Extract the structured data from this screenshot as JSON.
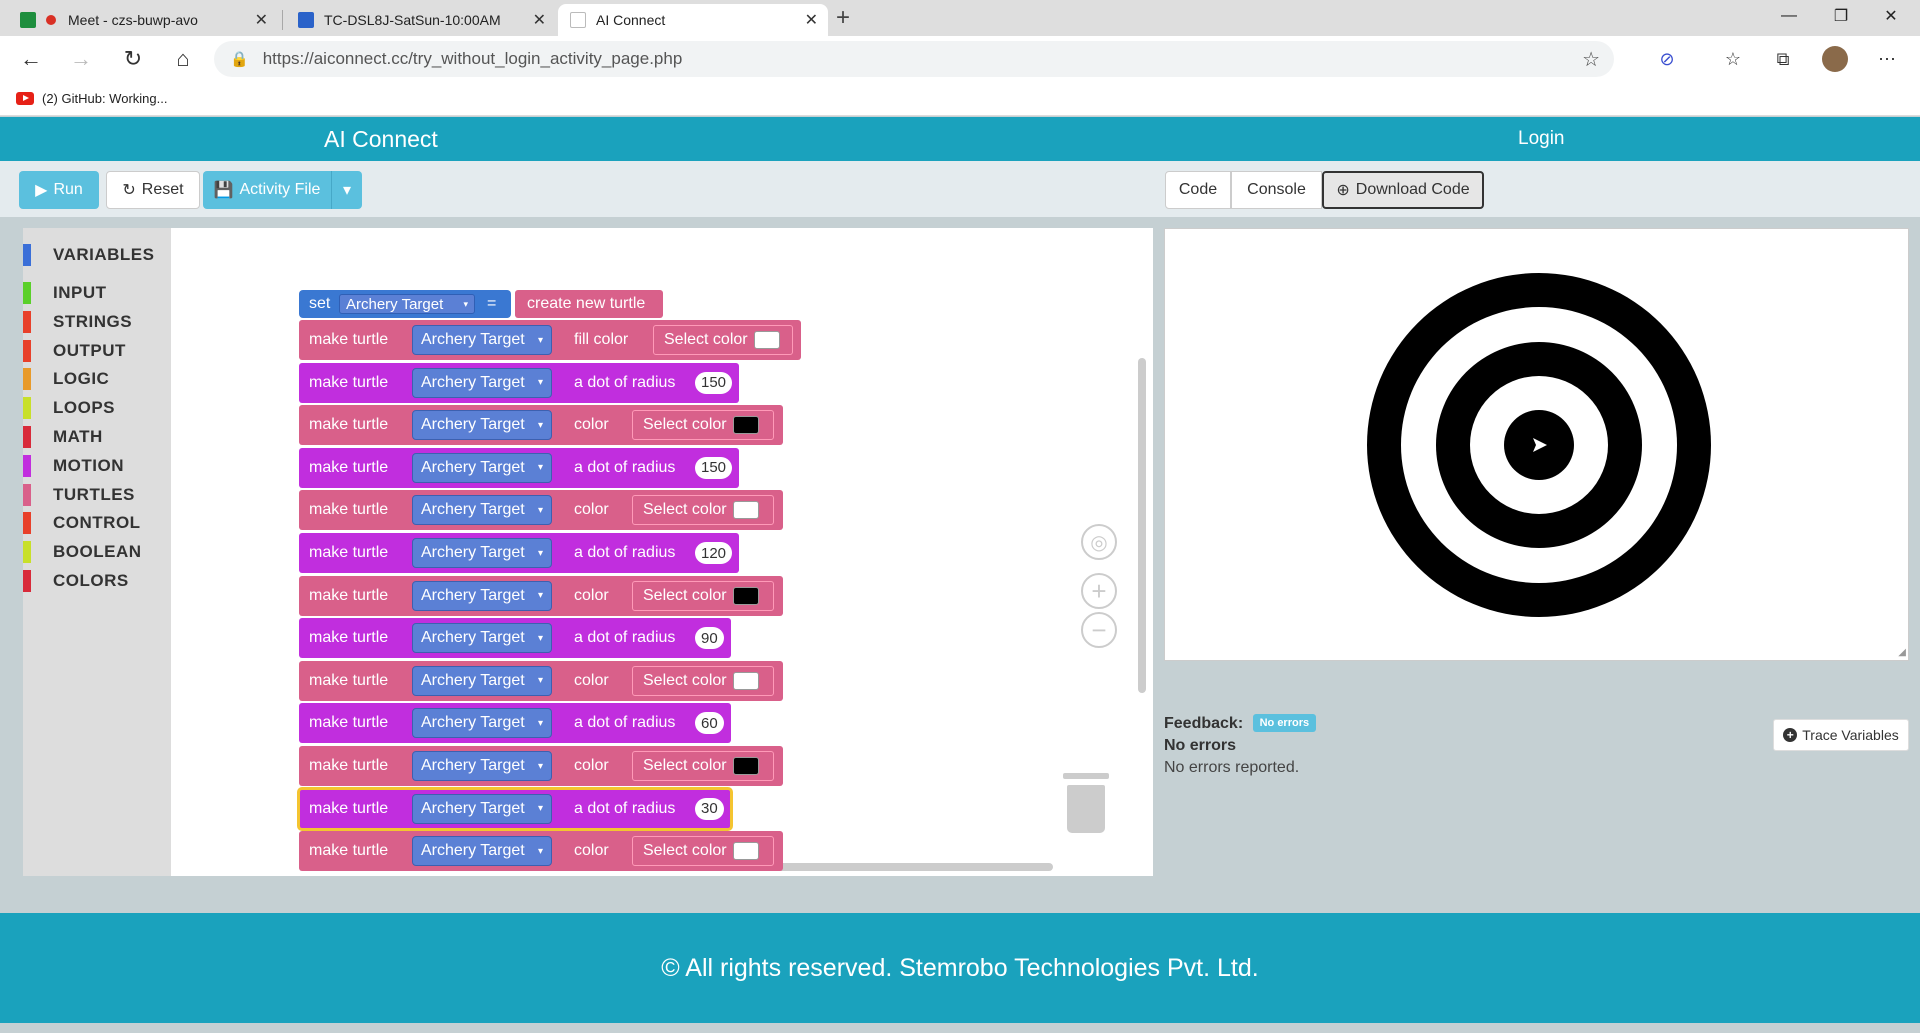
{
  "browser": {
    "tabs": [
      {
        "title": "Meet - czs-buwp-avo"
      },
      {
        "title": "TC-DSL8J-SatSun-10:00AM"
      },
      {
        "title": "AI Connect"
      }
    ],
    "url": "https://aiconnect.cc/try_without_login_activity_page.php",
    "bookmark": "(2) GitHub: Working..."
  },
  "app": {
    "brand": "AI Connect",
    "login": "Login"
  },
  "toolbar": {
    "run": "Run",
    "reset": "Reset",
    "activity_file": "Activity File",
    "code": "Code",
    "console": "Console",
    "download": "Download Code"
  },
  "categories": [
    {
      "label": "VARIABLES",
      "color": "#3a6fd8"
    },
    {
      "label": "INPUT",
      "color": "#5ad02a"
    },
    {
      "label": "STRINGS",
      "color": "#e8402a"
    },
    {
      "label": "OUTPUT",
      "color": "#e8402a"
    },
    {
      "label": "LOGIC",
      "color": "#e89a2a"
    },
    {
      "label": "LOOPS",
      "color": "#c8e02a"
    },
    {
      "label": "MATH",
      "color": "#d82a3a"
    },
    {
      "label": "MOTION",
      "color": "#c12ede"
    },
    {
      "label": "TURTLES",
      "color": "#d9608a"
    },
    {
      "label": "CONTROL",
      "color": "#e8402a"
    },
    {
      "label": "BOOLEAN",
      "color": "#c8e02a"
    },
    {
      "label": "COLORS",
      "color": "#d82a3a"
    }
  ],
  "program": {
    "set_kw": "set",
    "var_name": "Archery Target",
    "eq": "=",
    "create": "create new turtle",
    "make_turtle": "make turtle",
    "fill_color": "fill color",
    "dot_radius": "a dot of radius",
    "color": "color",
    "select_color": "Select color",
    "radii": [
      "150",
      "150",
      "120",
      "90",
      "60",
      "30"
    ]
  },
  "feedback": {
    "label": "Feedback:",
    "badge": "No errors",
    "heading": "No errors",
    "message": "No errors reported."
  },
  "trace": "Trace Variables",
  "footer": "© All rights reserved. Stemrobo Technologies Pvt. Ltd.",
  "colors": {
    "brand": "#1aa2bd",
    "turtle_block": "#d9608a",
    "motion_block": "#c12ede",
    "variable_block": "#3a78d2"
  }
}
